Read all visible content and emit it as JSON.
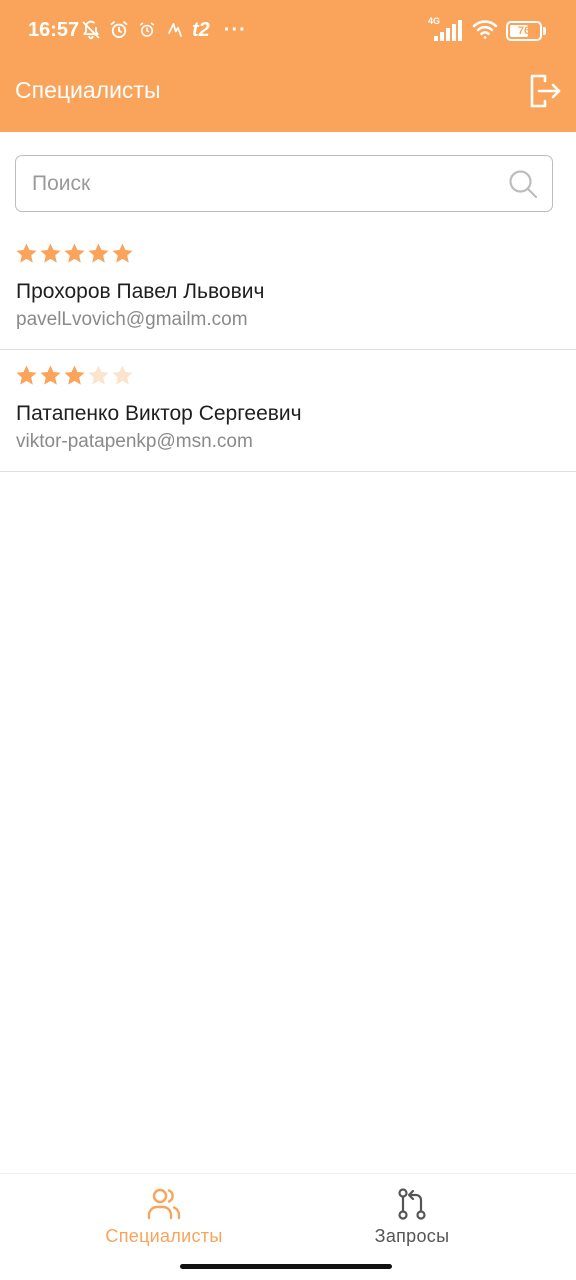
{
  "status_bar": {
    "time": "16:57",
    "carrier": "t2",
    "more": "···",
    "network": "4G",
    "battery_level": "76",
    "battery_fraction": 0.76
  },
  "header": {
    "title": "Специалисты"
  },
  "search": {
    "placeholder": "Поиск",
    "value": ""
  },
  "specialists": [
    {
      "name": "Прохоров Павел Львович",
      "email": "pavelLvovich@gmailm.com",
      "rating": 5,
      "max_rating": 5
    },
    {
      "name": "Патапенко Виктор Сергеевич",
      "email": "viktor-patapenkp@msn.com",
      "rating": 3,
      "max_rating": 5
    }
  ],
  "bottom_nav": {
    "tabs": [
      {
        "label": "Специалисты",
        "icon": "users-icon",
        "active": true
      },
      {
        "label": "Запросы",
        "icon": "git-compare-icon",
        "active": false
      }
    ]
  },
  "colors": {
    "accent": "#F9A45A",
    "star_filled": "#F9A45A",
    "star_empty": "#FCE3CC",
    "text_secondary": "#8A8A8A",
    "divider": "#DEDEDE"
  }
}
